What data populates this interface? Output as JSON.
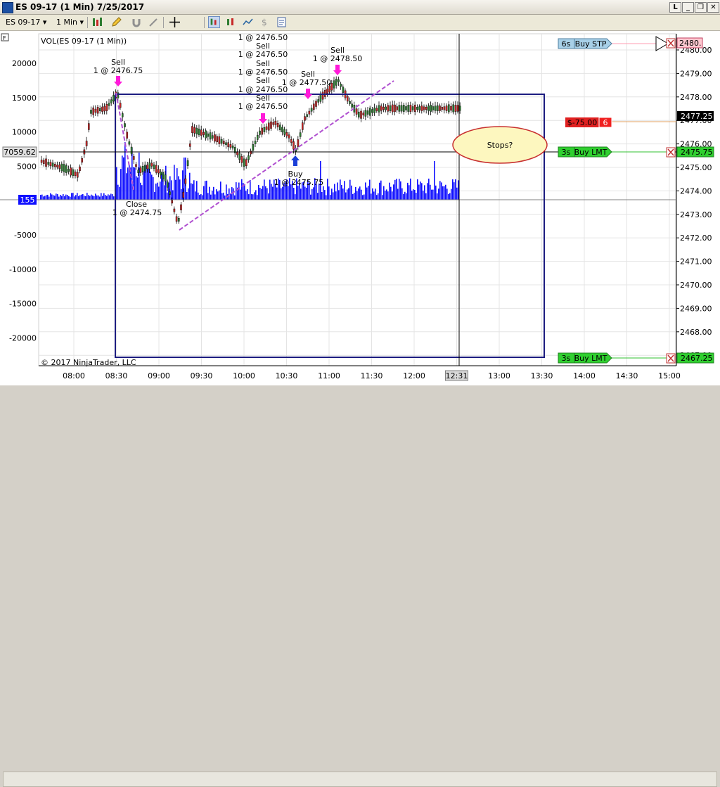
{
  "window": {
    "title": "ES 09-17 (1 Min)  7/25/2017"
  },
  "toolbar": {
    "instrument": "ES 09-17",
    "interval": "1 Min"
  },
  "chart": {
    "panel_label": "VOL(ES 09-17 (1 Min))",
    "copyright": "© 2017 NinjaTrader, LLC",
    "left_axis_ticks": [
      "20000",
      "15000",
      "10000",
      "5000",
      "0",
      "-5000",
      "-10000",
      "-15000",
      "-20000"
    ],
    "right_axis_ticks": [
      "2480.00",
      "2479.00",
      "2478.00",
      "2477.00",
      "2476.00",
      "2475.00",
      "2474.00",
      "2473.00",
      "2472.00",
      "2471.00",
      "2470.00",
      "2469.00",
      "2468.00",
      "2467.00"
    ],
    "time_ticks": [
      "08:00",
      "08:30",
      "09:00",
      "09:30",
      "10:00",
      "10:30",
      "11:00",
      "11:30",
      "12:00",
      "12:31",
      "13:00",
      "13:30",
      "14:00",
      "14:30",
      "15:00"
    ],
    "crosshair_value": "7059.62",
    "volume_marker": "155",
    "price_marker_high": "2480.",
    "current_price": "2477.25",
    "price_marker_2475": "2475.75",
    "price_marker_2467": "2467.25",
    "annotation_stops": "Stops?",
    "trade_labels": {
      "sell1_action": "Sell",
      "sell1_qty": "1 @ 2476.75",
      "close_action": "Close",
      "close_qty": "1 @ 2474.75",
      "buy_action": "Buy",
      "buy_qty": "1 @ 2475.75",
      "s_a": "1 @ 2476.50",
      "s_b_action": "Sell",
      "s_b_qty": "1 @ 2476.50",
      "s_c_action": "Sell",
      "s_c_qty": "1 @ 2476.50",
      "s_d_action": "Sell",
      "s_d_qty": "1 @ 2476.50",
      "s_e_action": "Sell",
      "s_e_qty": "1 @ 2476.50",
      "sell6_action": "Sell",
      "sell6_qty": "1 @ 2477.50",
      "sell7_action": "Sell",
      "sell7_qty": "1 @ 2478.50"
    }
  },
  "orders": {
    "buy_stp": {
      "time": "6s",
      "label": "Buy STP"
    },
    "position": {
      "pnl": "$-75.00",
      "qty": "6"
    },
    "buy_lmt_1": {
      "time": "3s",
      "label": "Buy LMT"
    },
    "buy_lmt_2": {
      "time": "3s",
      "label": "Buy LMT"
    }
  },
  "colors": {
    "up_bar": "#2e7d32",
    "down_bar": "#c62828",
    "volume": "#1010ff",
    "rectangle": "#1c1c80",
    "trend": "#b050d0",
    "ellipse_fill": "#fdf7bf",
    "ellipse_stroke": "#c83030"
  }
}
